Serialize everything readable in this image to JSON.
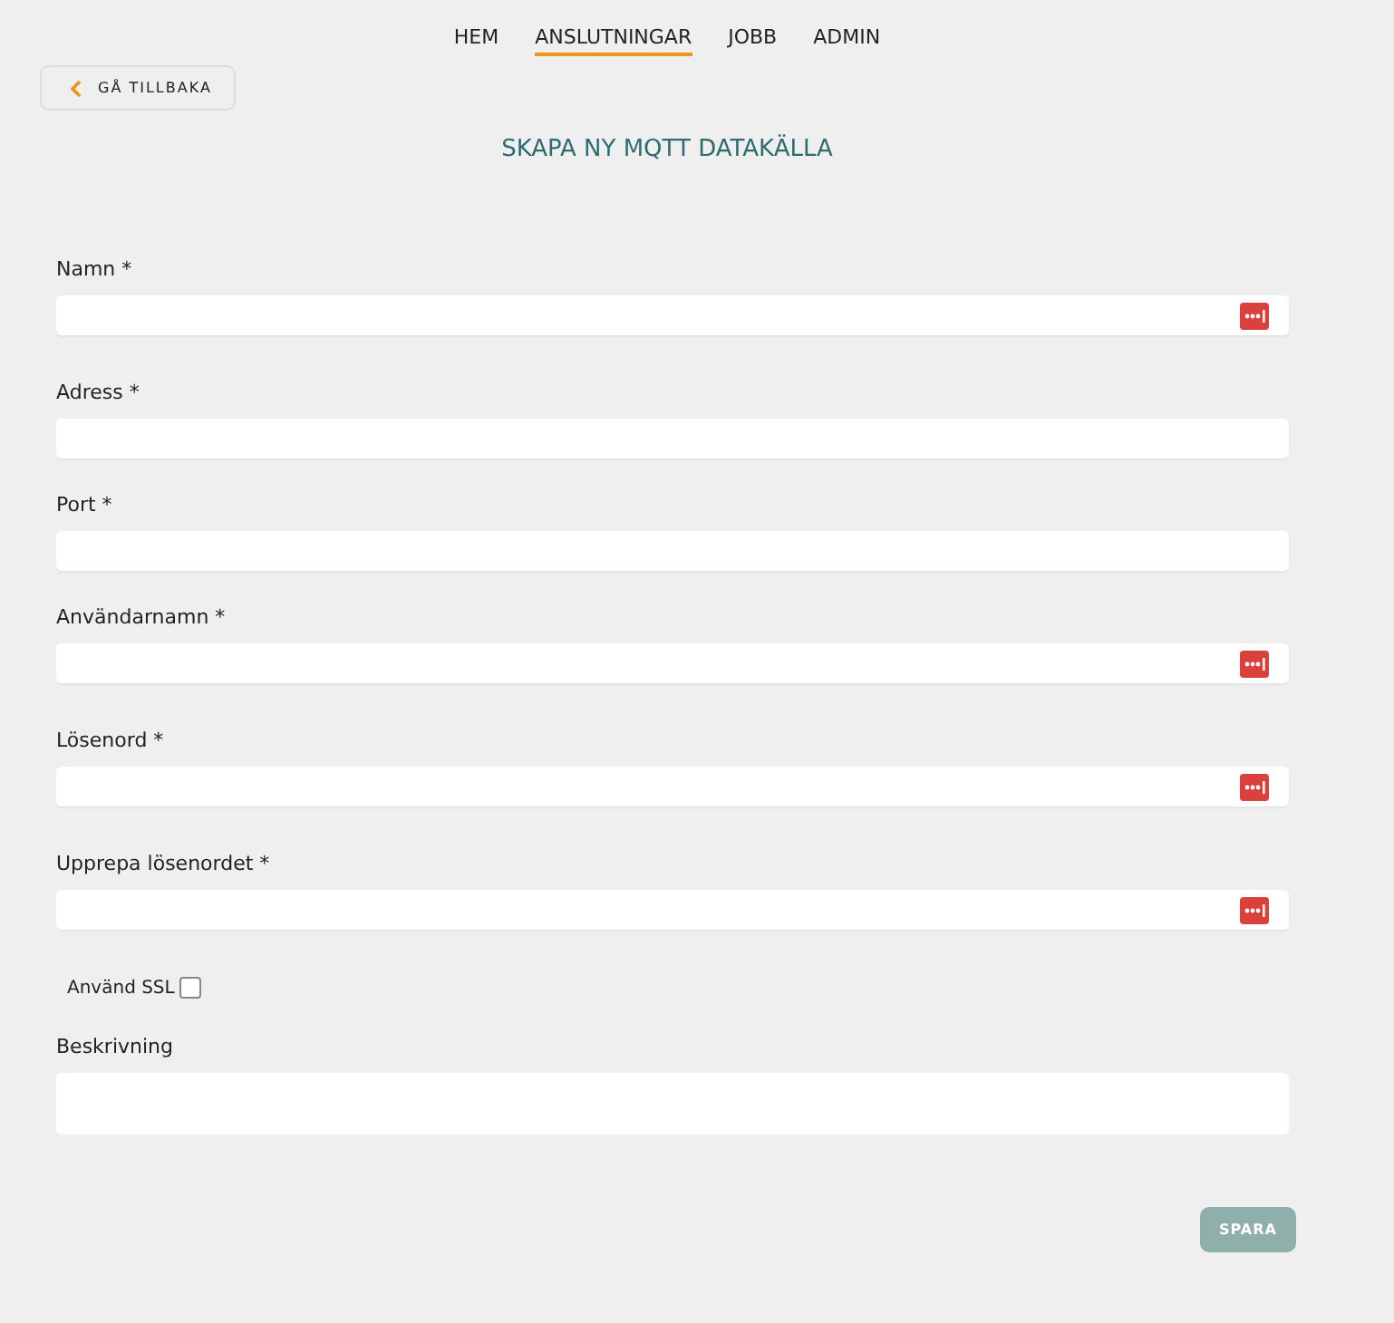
{
  "nav": [
    {
      "label": "HEM",
      "selected": false
    },
    {
      "label": "ANSLUTNINGAR",
      "selected": true
    },
    {
      "label": "JOBB",
      "selected": false
    },
    {
      "label": "ADMIN",
      "selected": false
    }
  ],
  "back_button": "GÅ TILLBAKA",
  "title": "SKAPA NY MQTT DATAKÄLLA",
  "fields": [
    {
      "label": "Namn *",
      "has_icon": true
    },
    {
      "label": "Adress *",
      "has_icon": false
    },
    {
      "label": "Port *",
      "has_icon": false
    },
    {
      "label": "Användarnamn *",
      "has_icon": true
    },
    {
      "label": "Lösenord *",
      "has_icon": true
    },
    {
      "label": "Upprepa lösenordet *",
      "has_icon": true
    }
  ],
  "ssl": {
    "label": "Använd SSL",
    "checked": false
  },
  "description": {
    "label": "Beskrivning"
  },
  "save_button": "SPARA"
}
